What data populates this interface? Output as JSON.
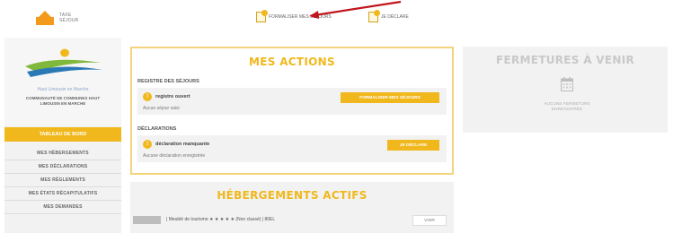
{
  "header": {
    "logo_line1": "TAXE",
    "logo_line2": "SÉJOUR",
    "action_registre": "Formaliser mes séjours",
    "action_declare": "Je déclare"
  },
  "sidebar": {
    "brand_tagline": "Haut Limousin en Marche",
    "brand_sub1": "Communauté de Communes Haut",
    "brand_sub2": "Limousin en Marche",
    "active_item": "Tableau de bord",
    "items": [
      {
        "label": "Mes hébergements"
      },
      {
        "label": "Mes déclarations"
      },
      {
        "label": "Mes règlements"
      },
      {
        "label": "Mes états récapitulatifs"
      },
      {
        "label": "Mes demandes"
      }
    ]
  },
  "actions": {
    "title": "MES ACTIONS",
    "registre": {
      "section": "REGISTRE DES SÉJOURS",
      "badge": "!",
      "title": "registre ouvert",
      "sub": "Aucun séjour saisi",
      "button": "Formaliser mes séjours"
    },
    "declarations": {
      "section": "DÉCLARATIONS",
      "badge": "!",
      "title": "déclaration manquante",
      "sub": "Aucune déclaration enregistrée",
      "button": "Je déclare"
    }
  },
  "hebergements": {
    "title": "HÉBERGEMENTS ACTIFS",
    "row_text": "| Meublé de tourisme ★ ★ ★ ★ ★ (Non classé) | 80EL",
    "button": "Voir"
  },
  "fermetures": {
    "title": "FERMETURES À VENIR",
    "empty_line1": "Aucune fermeture",
    "empty_line2": "enregistrée"
  },
  "colors": {
    "accent": "#f0b81c",
    "panel_bg": "#f2f2f2",
    "arrow": "#c0161c"
  }
}
